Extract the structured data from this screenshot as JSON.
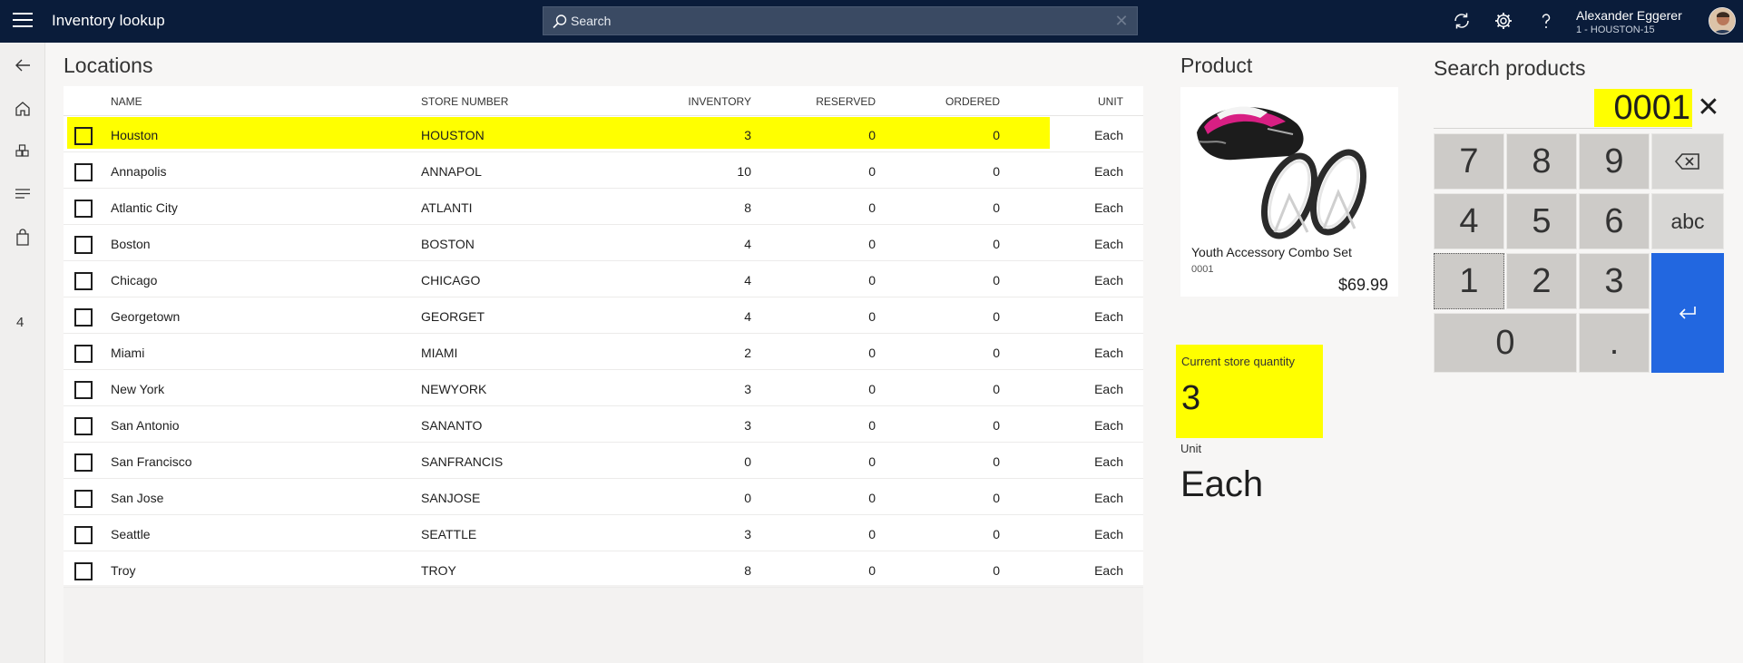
{
  "header": {
    "app_title": "Inventory lookup",
    "search_placeholder": "Search",
    "user_name": "Alexander Eggerer",
    "user_store": "1 - HOUSTON-15"
  },
  "rail": {
    "badge_count": "4"
  },
  "locations": {
    "title": "Locations",
    "columns": [
      "NAME",
      "STORE NUMBER",
      "INVENTORY",
      "RESERVED",
      "ORDERED",
      "UNIT"
    ],
    "rows": [
      {
        "name": "Houston",
        "store": "HOUSTON",
        "inventory": "3",
        "reserved": "0",
        "ordered": "0",
        "unit": "Each",
        "selected": true
      },
      {
        "name": "Annapolis",
        "store": "ANNAPOL",
        "inventory": "10",
        "reserved": "0",
        "ordered": "0",
        "unit": "Each"
      },
      {
        "name": "Atlantic City",
        "store": "ATLANTI",
        "inventory": "8",
        "reserved": "0",
        "ordered": "0",
        "unit": "Each"
      },
      {
        "name": "Boston",
        "store": "BOSTON",
        "inventory": "4",
        "reserved": "0",
        "ordered": "0",
        "unit": "Each"
      },
      {
        "name": "Chicago",
        "store": "CHICAGO",
        "inventory": "4",
        "reserved": "0",
        "ordered": "0",
        "unit": "Each"
      },
      {
        "name": "Georgetown",
        "store": "GEORGET",
        "inventory": "4",
        "reserved": "0",
        "ordered": "0",
        "unit": "Each"
      },
      {
        "name": "Miami",
        "store": "MIAMI",
        "inventory": "2",
        "reserved": "0",
        "ordered": "0",
        "unit": "Each"
      },
      {
        "name": "New York",
        "store": "NEWYORK",
        "inventory": "3",
        "reserved": "0",
        "ordered": "0",
        "unit": "Each"
      },
      {
        "name": "San Antonio",
        "store": "SANANTO",
        "inventory": "3",
        "reserved": "0",
        "ordered": "0",
        "unit": "Each"
      },
      {
        "name": "San Francisco",
        "store": "SANFRANCIS",
        "inventory": "0",
        "reserved": "0",
        "ordered": "0",
        "unit": "Each"
      },
      {
        "name": "San Jose",
        "store": "SANJOSE",
        "inventory": "0",
        "reserved": "0",
        "ordered": "0",
        "unit": "Each"
      },
      {
        "name": "Seattle",
        "store": "SEATTLE",
        "inventory": "3",
        "reserved": "0",
        "ordered": "0",
        "unit": "Each"
      },
      {
        "name": "Troy",
        "store": "TROY",
        "inventory": "8",
        "reserved": "0",
        "ordered": "0",
        "unit": "Each"
      }
    ]
  },
  "product": {
    "title": "Product",
    "name": "Youth Accessory Combo Set",
    "sku": "0001",
    "price": "$69.99",
    "current_qty_label": "Current store quantity",
    "current_qty": "3",
    "unit_label": "Unit",
    "unit": "Each"
  },
  "numpad": {
    "title": "Search products",
    "value": "0001",
    "keys": [
      "7",
      "8",
      "9",
      "4",
      "5",
      "6",
      "1",
      "2",
      "3",
      "0",
      "."
    ],
    "abc_label": "abc"
  },
  "colors": {
    "topbar": "#0a1c3a",
    "highlight": "#ffff00",
    "enter_key": "#2267e0"
  }
}
